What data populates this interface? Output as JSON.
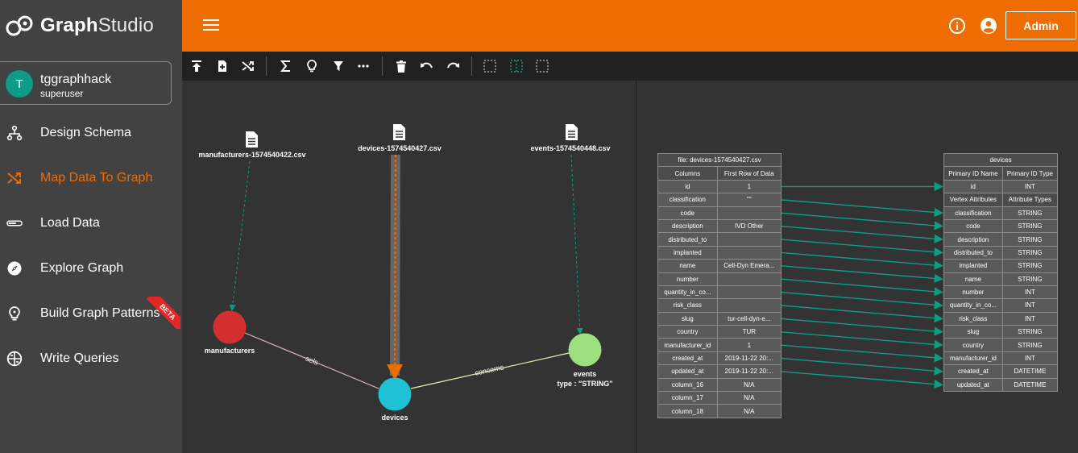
{
  "app": {
    "name_bold": "Graph",
    "name_light": "Studio"
  },
  "user": {
    "initial": "T",
    "name": "tggraphhack",
    "role": "superuser"
  },
  "nav": [
    {
      "label": "Design Schema",
      "icon": "schema-icon"
    },
    {
      "label": "Map Data To Graph",
      "icon": "shuffle-icon",
      "active": true
    },
    {
      "label": "Load Data",
      "icon": "load-data-icon"
    },
    {
      "label": "Explore Graph",
      "icon": "compass-icon"
    },
    {
      "label": "Build Graph Patterns",
      "icon": "lightbulb-icon"
    },
    {
      "label": "Write Queries",
      "icon": "query-icon"
    }
  ],
  "beta_label": "BETA",
  "topbar": {
    "admin_label": "Admin"
  },
  "colors": {
    "accent": "#ef6c00",
    "manufacturers": "#d32f2f",
    "devices": "#1ec2d4",
    "events": "#9be07d",
    "mapping": "#0e9c86"
  },
  "graph": {
    "files": [
      {
        "name": "manufacturers-1574540422.csv"
      },
      {
        "name": "devices-1574540427.csv"
      },
      {
        "name": "events-1574540448.csv"
      }
    ],
    "vertices": [
      {
        "label": "manufacturers"
      },
      {
        "label": "devices"
      },
      {
        "label": "events",
        "sub": "type : \"STRING\""
      }
    ],
    "edges": [
      {
        "label": "sels"
      },
      {
        "label": "concerns"
      }
    ]
  },
  "source_table": {
    "title": "file: devices-1574540427.csv",
    "headers": [
      "Columns",
      "First Row of Data"
    ],
    "rows": [
      [
        "id",
        "1"
      ],
      [
        "classification",
        "\"\""
      ],
      [
        "code",
        ""
      ],
      [
        "description",
        "IVD Other"
      ],
      [
        "distributed_to",
        ""
      ],
      [
        "implanted",
        ""
      ],
      [
        "name",
        "Cell-Dyn Emera..."
      ],
      [
        "number",
        ""
      ],
      [
        "quantity_in_co...",
        ""
      ],
      [
        "risk_class",
        ""
      ],
      [
        "slug",
        "tur-cell-dyn-e..."
      ],
      [
        "country",
        "TUR"
      ],
      [
        "manufacturer_id",
        "1"
      ],
      [
        "created_at",
        "2019-11-22 20:..."
      ],
      [
        "updated_at",
        "2019-11-22 20:..."
      ],
      [
        "column_16",
        "N/A"
      ],
      [
        "column_17",
        "N/A"
      ],
      [
        "column_18",
        "N/A"
      ]
    ]
  },
  "target_table": {
    "title": "devices",
    "id_headers": [
      "Primary ID Name",
      "Primary ID Type"
    ],
    "id_row": [
      "id",
      "INT"
    ],
    "attr_headers": [
      "Vertex Attributes",
      "Attribute Types"
    ],
    "rows": [
      [
        "classification",
        "STRING"
      ],
      [
        "code",
        "STRING"
      ],
      [
        "description",
        "STRING"
      ],
      [
        "distributed_to",
        "STRING"
      ],
      [
        "implanted",
        "STRING"
      ],
      [
        "name",
        "STRING"
      ],
      [
        "number",
        "INT"
      ],
      [
        "quantity_in_co...",
        "INT"
      ],
      [
        "risk_class",
        "INT"
      ],
      [
        "slug",
        "STRING"
      ],
      [
        "country",
        "STRING"
      ],
      [
        "manufacturer_id",
        "INT"
      ],
      [
        "created_at",
        "DATETIME"
      ],
      [
        "updated_at",
        "DATETIME"
      ]
    ]
  }
}
